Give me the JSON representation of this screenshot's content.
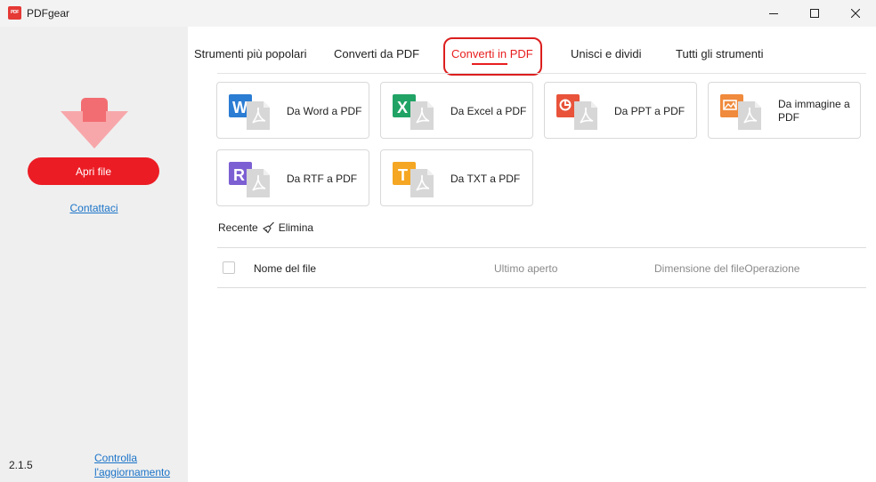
{
  "app": {
    "title": "PDFgear",
    "logo_text": "PDF"
  },
  "sidebar": {
    "open_button": "Apri file",
    "contact_link": "Contattaci",
    "version": "2.1.5",
    "update_link_line1": "Controlla",
    "update_link_line2": "l'aggiornamento"
  },
  "tabs": [
    {
      "label": "Strumenti più popolari",
      "active": false
    },
    {
      "label": "Converti da PDF",
      "active": false
    },
    {
      "label": "Converti in PDF",
      "active": true
    },
    {
      "label": "Unisci e dividi",
      "active": false
    },
    {
      "label": "Tutti gli strumenti",
      "active": false
    }
  ],
  "tools": [
    {
      "label": "Da Word a PDF",
      "icon": "word-to-pdf-icon",
      "letter": "W",
      "color": "#2b7cd3"
    },
    {
      "label": "Da Excel a PDF",
      "icon": "excel-to-pdf-icon",
      "letter": "X",
      "color": "#21a366"
    },
    {
      "label": "Da PPT a PDF",
      "icon": "ppt-to-pdf-icon",
      "letter": "P",
      "color": "#e8533a"
    },
    {
      "label_line1": "Da immagine a",
      "label_line2": "PDF",
      "icon": "image-to-pdf-icon",
      "color": "#f08a3c"
    },
    {
      "label": "Da RTF a PDF",
      "icon": "rtf-to-pdf-icon",
      "letter": "R",
      "color": "#7c5fd3"
    },
    {
      "label": "Da TXT a PDF",
      "icon": "txt-to-pdf-icon",
      "letter": "T",
      "color": "#f5a623"
    }
  ],
  "recent": {
    "label": "Recente",
    "clear_label": "Elimina"
  },
  "table": {
    "columns": {
      "name": "Nome del file",
      "last_opened": "Ultimo aperto",
      "size_and_op": "Dimensione del fileOperazione"
    }
  }
}
